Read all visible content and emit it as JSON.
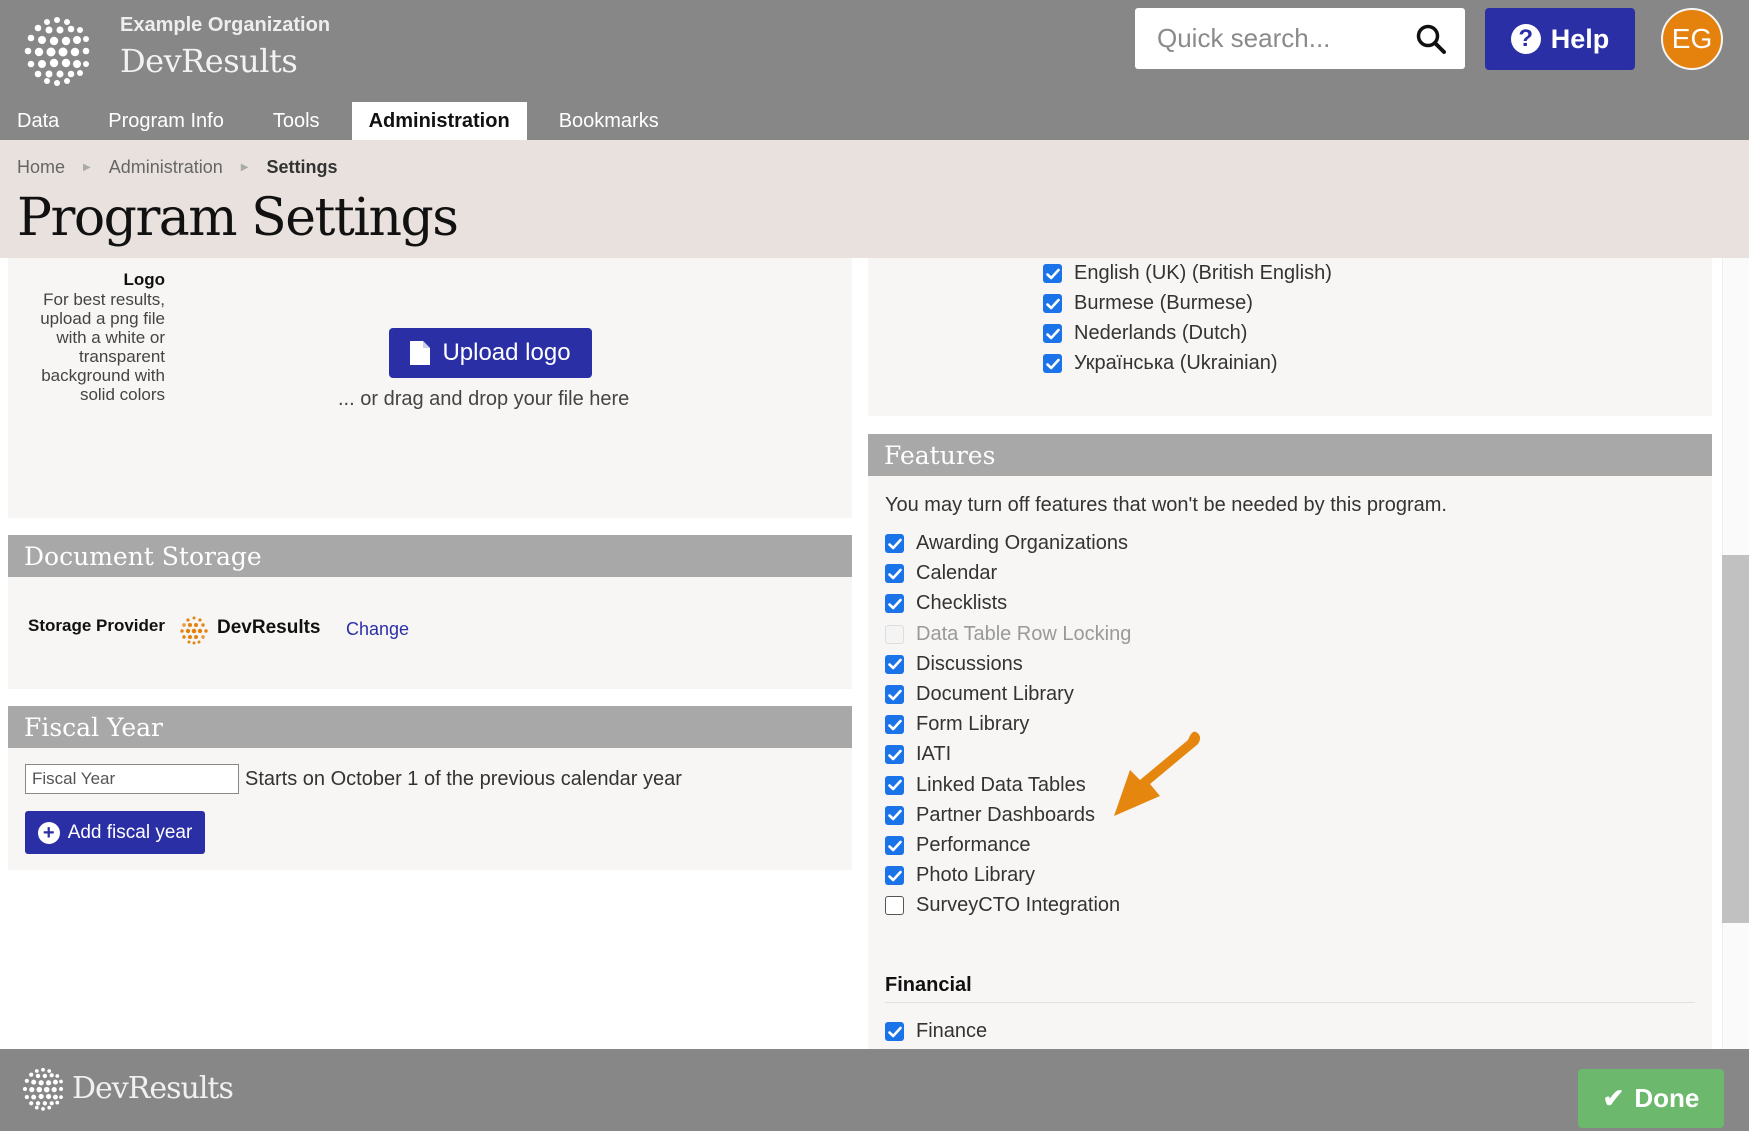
{
  "header": {
    "org_name": "Example Organization",
    "brand": "DevResults",
    "search": {
      "placeholder": "Quick search..."
    },
    "help_label": "Help",
    "avatar_initials": "EG",
    "accent_color": "#2b2fa6",
    "avatar_color": "#e5820e"
  },
  "nav": {
    "tabs": [
      {
        "label": "Data",
        "active": false
      },
      {
        "label": "Program Info",
        "active": false
      },
      {
        "label": "Tools",
        "active": false
      },
      {
        "label": "Administration",
        "active": true
      },
      {
        "label": "Bookmarks",
        "active": false
      }
    ]
  },
  "breadcrumb": [
    "Home",
    "Administration",
    "Settings"
  ],
  "page_title": "Program Settings",
  "logo_section": {
    "label": "Logo",
    "hint": "For best results, upload a png file with a white or transparent background with solid colors",
    "upload_label": "Upload logo",
    "drop_hint": "... or drag and drop your file here"
  },
  "document_storage": {
    "title": "Document Storage",
    "provider_label": "Storage Provider",
    "provider_name": "DevResults",
    "change_label": "Change"
  },
  "fiscal_year": {
    "title": "Fiscal Year",
    "input_placeholder": "Fiscal Year",
    "description": "Starts on October 1 of the previous calendar year",
    "add_label": "Add fiscal year"
  },
  "languages": [
    {
      "label": "English (UK) (British English)",
      "checked": true
    },
    {
      "label": "Burmese (Burmese)",
      "checked": true
    },
    {
      "label": "Nederlands (Dutch)",
      "checked": true
    },
    {
      "label": "Українська (Ukrainian)",
      "checked": true
    }
  ],
  "features": {
    "title": "Features",
    "intro": "You may turn off features that won't be needed by this program.",
    "items": [
      {
        "label": "Awarding Organizations",
        "state": "checked"
      },
      {
        "label": "Calendar",
        "state": "checked"
      },
      {
        "label": "Checklists",
        "state": "checked"
      },
      {
        "label": "Data Table Row Locking",
        "state": "disabled"
      },
      {
        "label": "Discussions",
        "state": "checked"
      },
      {
        "label": "Document Library",
        "state": "checked"
      },
      {
        "label": "Form Library",
        "state": "checked"
      },
      {
        "label": "IATI",
        "state": "checked"
      },
      {
        "label": "Linked Data Tables",
        "state": "checked"
      },
      {
        "label": "Partner Dashboards",
        "state": "checked"
      },
      {
        "label": "Performance",
        "state": "checked"
      },
      {
        "label": "Photo Library",
        "state": "checked"
      },
      {
        "label": "SurveyCTO Integration",
        "state": "unchecked"
      }
    ],
    "financial_heading": "Financial",
    "financial_items": [
      {
        "label": "Finance",
        "state": "checked"
      }
    ],
    "annotation_arrow_icon": "orange-arrow-icon"
  },
  "footer": {
    "brand": "DevResults",
    "done_label": "Done"
  }
}
